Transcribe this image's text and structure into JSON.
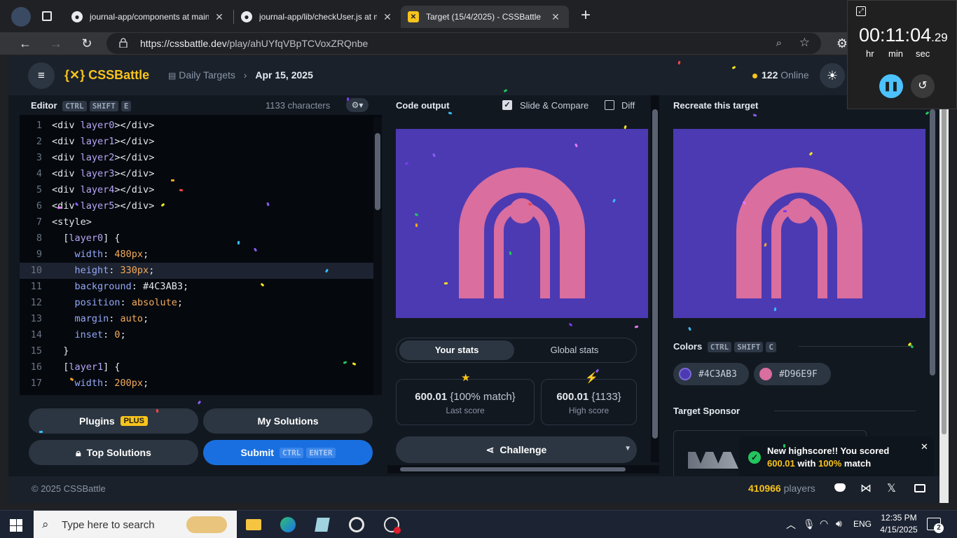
{
  "browser": {
    "tabs": [
      {
        "title": "journal-app/components at main",
        "favicon": "github-icon"
      },
      {
        "title": "journal-app/lib/checkUser.js at m",
        "favicon": "github-icon"
      },
      {
        "title": "Target (15/4/2025) - CSSBattle",
        "favicon": "cssbattle-icon",
        "active": true
      }
    ],
    "address_host": "https://cssbattle.dev",
    "address_path": "/play/ahUYfqVBpTCVoxZRQnbe"
  },
  "header": {
    "brand": "{✕} CSSBattle",
    "crumb_parent": "Daily Targets",
    "crumb_current": "Apr 15, 2025",
    "online": "122",
    "online_label": "Online"
  },
  "editor": {
    "title": "Editor",
    "shortcut": [
      "CTRL",
      "SHIFT",
      "E"
    ],
    "char_count": "1133 characters",
    "lines": [
      {
        "n": "1",
        "parts": [
          [
            "tg",
            "<div "
          ],
          [
            "at",
            "layer0"
          ],
          [
            "tg",
            "></div>"
          ]
        ]
      },
      {
        "n": "2",
        "parts": [
          [
            "tg",
            "<div "
          ],
          [
            "at",
            "layer1"
          ],
          [
            "tg",
            "></div>"
          ]
        ]
      },
      {
        "n": "3",
        "parts": [
          [
            "tg",
            "<div "
          ],
          [
            "at",
            "layer2"
          ],
          [
            "tg",
            "></div>"
          ]
        ]
      },
      {
        "n": "4",
        "parts": [
          [
            "tg",
            "<div "
          ],
          [
            "at",
            "layer3"
          ],
          [
            "tg",
            "></div>"
          ]
        ]
      },
      {
        "n": "5",
        "parts": [
          [
            "tg",
            "<div "
          ],
          [
            "at",
            "layer4"
          ],
          [
            "tg",
            "></div>"
          ]
        ]
      },
      {
        "n": "6",
        "parts": [
          [
            "tg",
            "<div "
          ],
          [
            "at",
            "layer5"
          ],
          [
            "tg",
            "></div>"
          ]
        ]
      },
      {
        "n": "7",
        "parts": [
          [
            "tg",
            "<style>"
          ]
        ]
      },
      {
        "n": "8",
        "parts": [
          [
            "tg",
            "  ["
          ],
          [
            "at",
            "layer0"
          ],
          [
            "tg",
            "] {"
          ]
        ]
      },
      {
        "n": "9",
        "parts": [
          [
            "pr",
            "    width"
          ],
          [
            "tg",
            ": "
          ],
          [
            "vl",
            "480px"
          ],
          [
            "tg",
            ";"
          ]
        ]
      },
      {
        "n": "10",
        "parts": [
          [
            "pr",
            "    height"
          ],
          [
            "tg",
            ": "
          ],
          [
            "vl",
            "330px"
          ],
          [
            "tg",
            ";"
          ]
        ],
        "hl": true
      },
      {
        "n": "11",
        "parts": [
          [
            "pr",
            "    background"
          ],
          [
            "tg",
            ": #4C3AB3;"
          ]
        ]
      },
      {
        "n": "12",
        "parts": [
          [
            "pr",
            "    position"
          ],
          [
            "tg",
            ": "
          ],
          [
            "vl",
            "absolute"
          ],
          [
            "tg",
            ";"
          ]
        ]
      },
      {
        "n": "13",
        "parts": [
          [
            "pr",
            "    margin"
          ],
          [
            "tg",
            ": "
          ],
          [
            "vl",
            "auto"
          ],
          [
            "tg",
            ";"
          ]
        ]
      },
      {
        "n": "14",
        "parts": [
          [
            "pr",
            "    inset"
          ],
          [
            "tg",
            ": "
          ],
          [
            "vl",
            "0"
          ],
          [
            "tg",
            ";"
          ]
        ]
      },
      {
        "n": "15",
        "parts": [
          [
            "tg",
            "  }"
          ]
        ]
      },
      {
        "n": "16",
        "parts": [
          [
            "tg",
            "  ["
          ],
          [
            "at",
            "layer1"
          ],
          [
            "tg",
            "] {"
          ]
        ]
      },
      {
        "n": "17",
        "parts": [
          [
            "pr",
            "    width"
          ],
          [
            "tg",
            ": "
          ],
          [
            "vl",
            "200px"
          ],
          [
            "tg",
            ";"
          ]
        ]
      }
    ]
  },
  "buttons": {
    "plugins": "Plugins",
    "plugins_badge": "PLUS",
    "my_solutions": "My Solutions",
    "top_solutions": "Top Solutions",
    "submit": "Submit",
    "submit_shortcut": [
      "CTRL",
      "ENTER"
    ]
  },
  "output": {
    "title": "Code output",
    "slide_compare": "Slide & Compare",
    "diff": "Diff",
    "tab_your": "Your stats",
    "tab_global": "Global stats",
    "last_score": "600.01",
    "last_match": "{100% match}",
    "last_label": "Last score",
    "high_score": "600.01",
    "high_chars": "{1133}",
    "high_label": "High score",
    "challenge": "Challenge"
  },
  "target": {
    "title": "Recreate this target",
    "colors_title": "Colors",
    "colors_shortcut": [
      "CTRL",
      "SHIFT",
      "C"
    ],
    "colors": [
      "#4C3AB3",
      "#D96E9F"
    ],
    "sponsor_title": "Target Sponsor"
  },
  "toast": {
    "line1": "New highscore!! You scored",
    "score": "600.01",
    "with": "with",
    "match": "100%",
    "match_label": "match"
  },
  "footer": {
    "copyright": "© 2025 CSSBattle",
    "players": "410966",
    "players_label": "players"
  },
  "timer": {
    "time": "00:11:04",
    "fraction": ".29",
    "labels": [
      "hr",
      "min",
      "sec"
    ]
  },
  "taskbar": {
    "search_placeholder": "Type here to search",
    "lang": "ENG",
    "time": "12:35 PM",
    "date": "4/15/2025",
    "notifications": "2"
  },
  "colors": {
    "accent": "#f8c31c",
    "submit_blue": "#1a6fe0",
    "bg": "#4C3AB3",
    "pink": "#D96E9F"
  }
}
